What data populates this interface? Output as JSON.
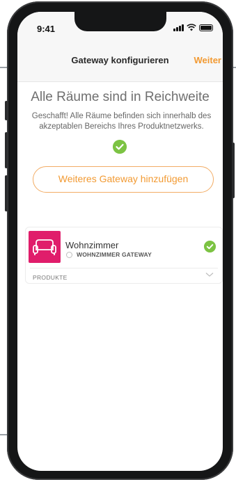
{
  "status": {
    "time": "9:41"
  },
  "nav": {
    "title": "Gateway konfigurieren",
    "action": "Weiter"
  },
  "content": {
    "heading": "Alle Räume sind in Reichweite",
    "subtext": "Geschafft! Alle Räume befinden sich innerhalb des akzeptablen Bereichs Ihres Produktnetzwerks.",
    "add_gateway_label": "Weiteres Gateway hinzufügen"
  },
  "room": {
    "name": "Wohnzimmer",
    "gateway": "WOHNZIMMER GATEWAY",
    "products_label": "PRODUKTE"
  },
  "colors": {
    "accent": "#f29a32",
    "success": "#7cc343",
    "room_tile": "#e01d6b"
  },
  "icons": [
    "signal-icon",
    "wifi-icon",
    "battery-icon",
    "check-icon",
    "sofa-icon",
    "spinner-icon",
    "chevron-down-icon"
  ]
}
